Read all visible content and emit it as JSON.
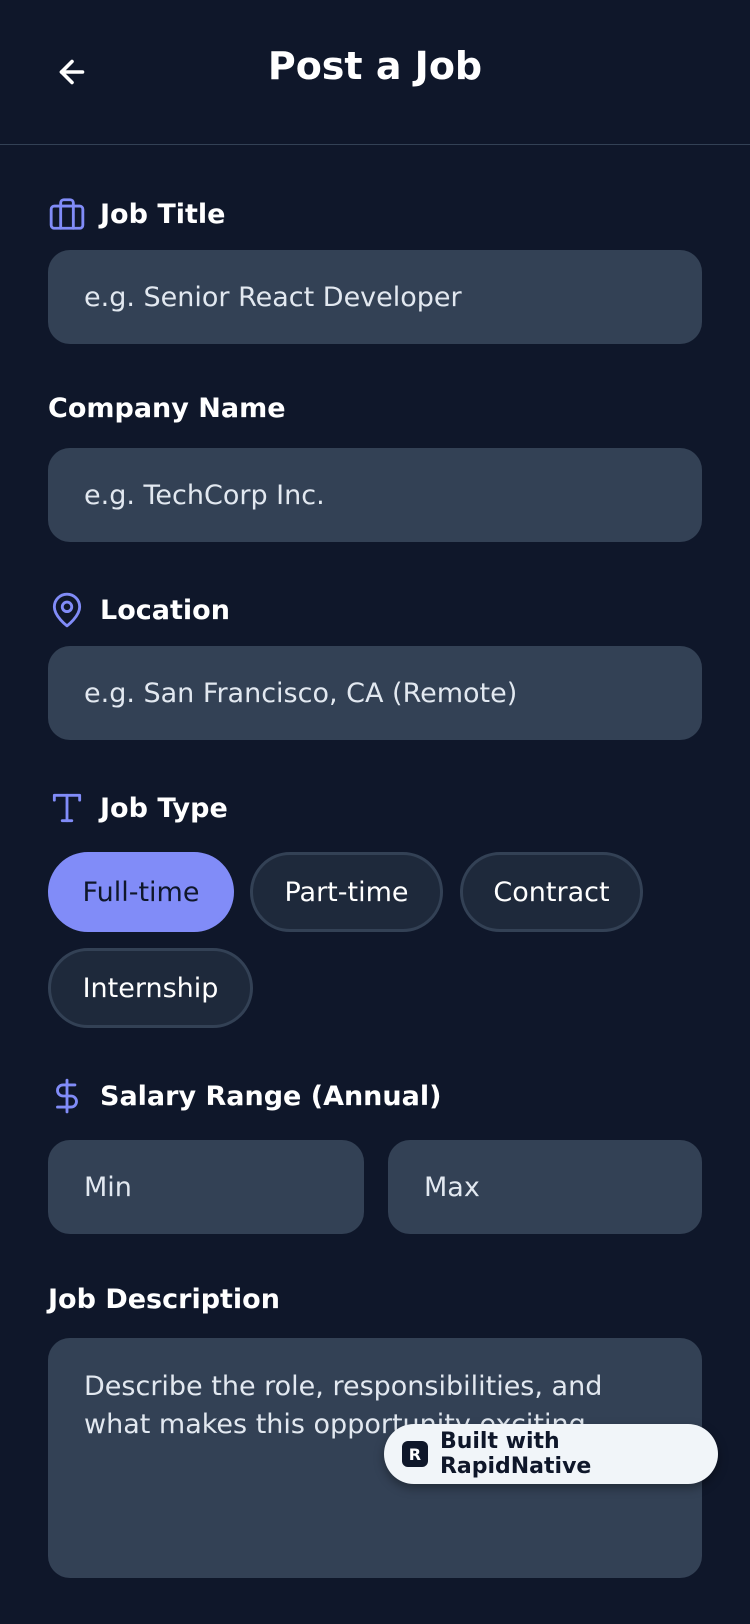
{
  "header": {
    "title": "Post a Job",
    "back_icon": "arrow-left-icon"
  },
  "form": {
    "job_title": {
      "label": "Job Title",
      "icon": "briefcase-icon",
      "placeholder": "e.g. Senior React Developer"
    },
    "company_name": {
      "label": "Company Name",
      "placeholder": "e.g. TechCorp Inc."
    },
    "location": {
      "label": "Location",
      "icon": "map-pin-icon",
      "placeholder": "e.g. San Francisco, CA (Remote)"
    },
    "job_type": {
      "label": "Job Type",
      "icon": "type-icon",
      "options": [
        "Full-time",
        "Part-time",
        "Contract",
        "Internship"
      ],
      "selected": "Full-time"
    },
    "salary": {
      "label": "Salary Range (Annual)",
      "icon": "dollar-sign-icon",
      "min_placeholder": "Min",
      "max_placeholder": "Max"
    },
    "description": {
      "label": "Job Description",
      "placeholder": "Describe the role, responsibilities, and what makes this opportunity exciting..."
    }
  },
  "badge": {
    "label": "Built with RapidNative"
  },
  "colors": {
    "background": "#0f172a",
    "field": "#334155",
    "accent": "#818cf8",
    "chip_bg": "#1e293b"
  }
}
